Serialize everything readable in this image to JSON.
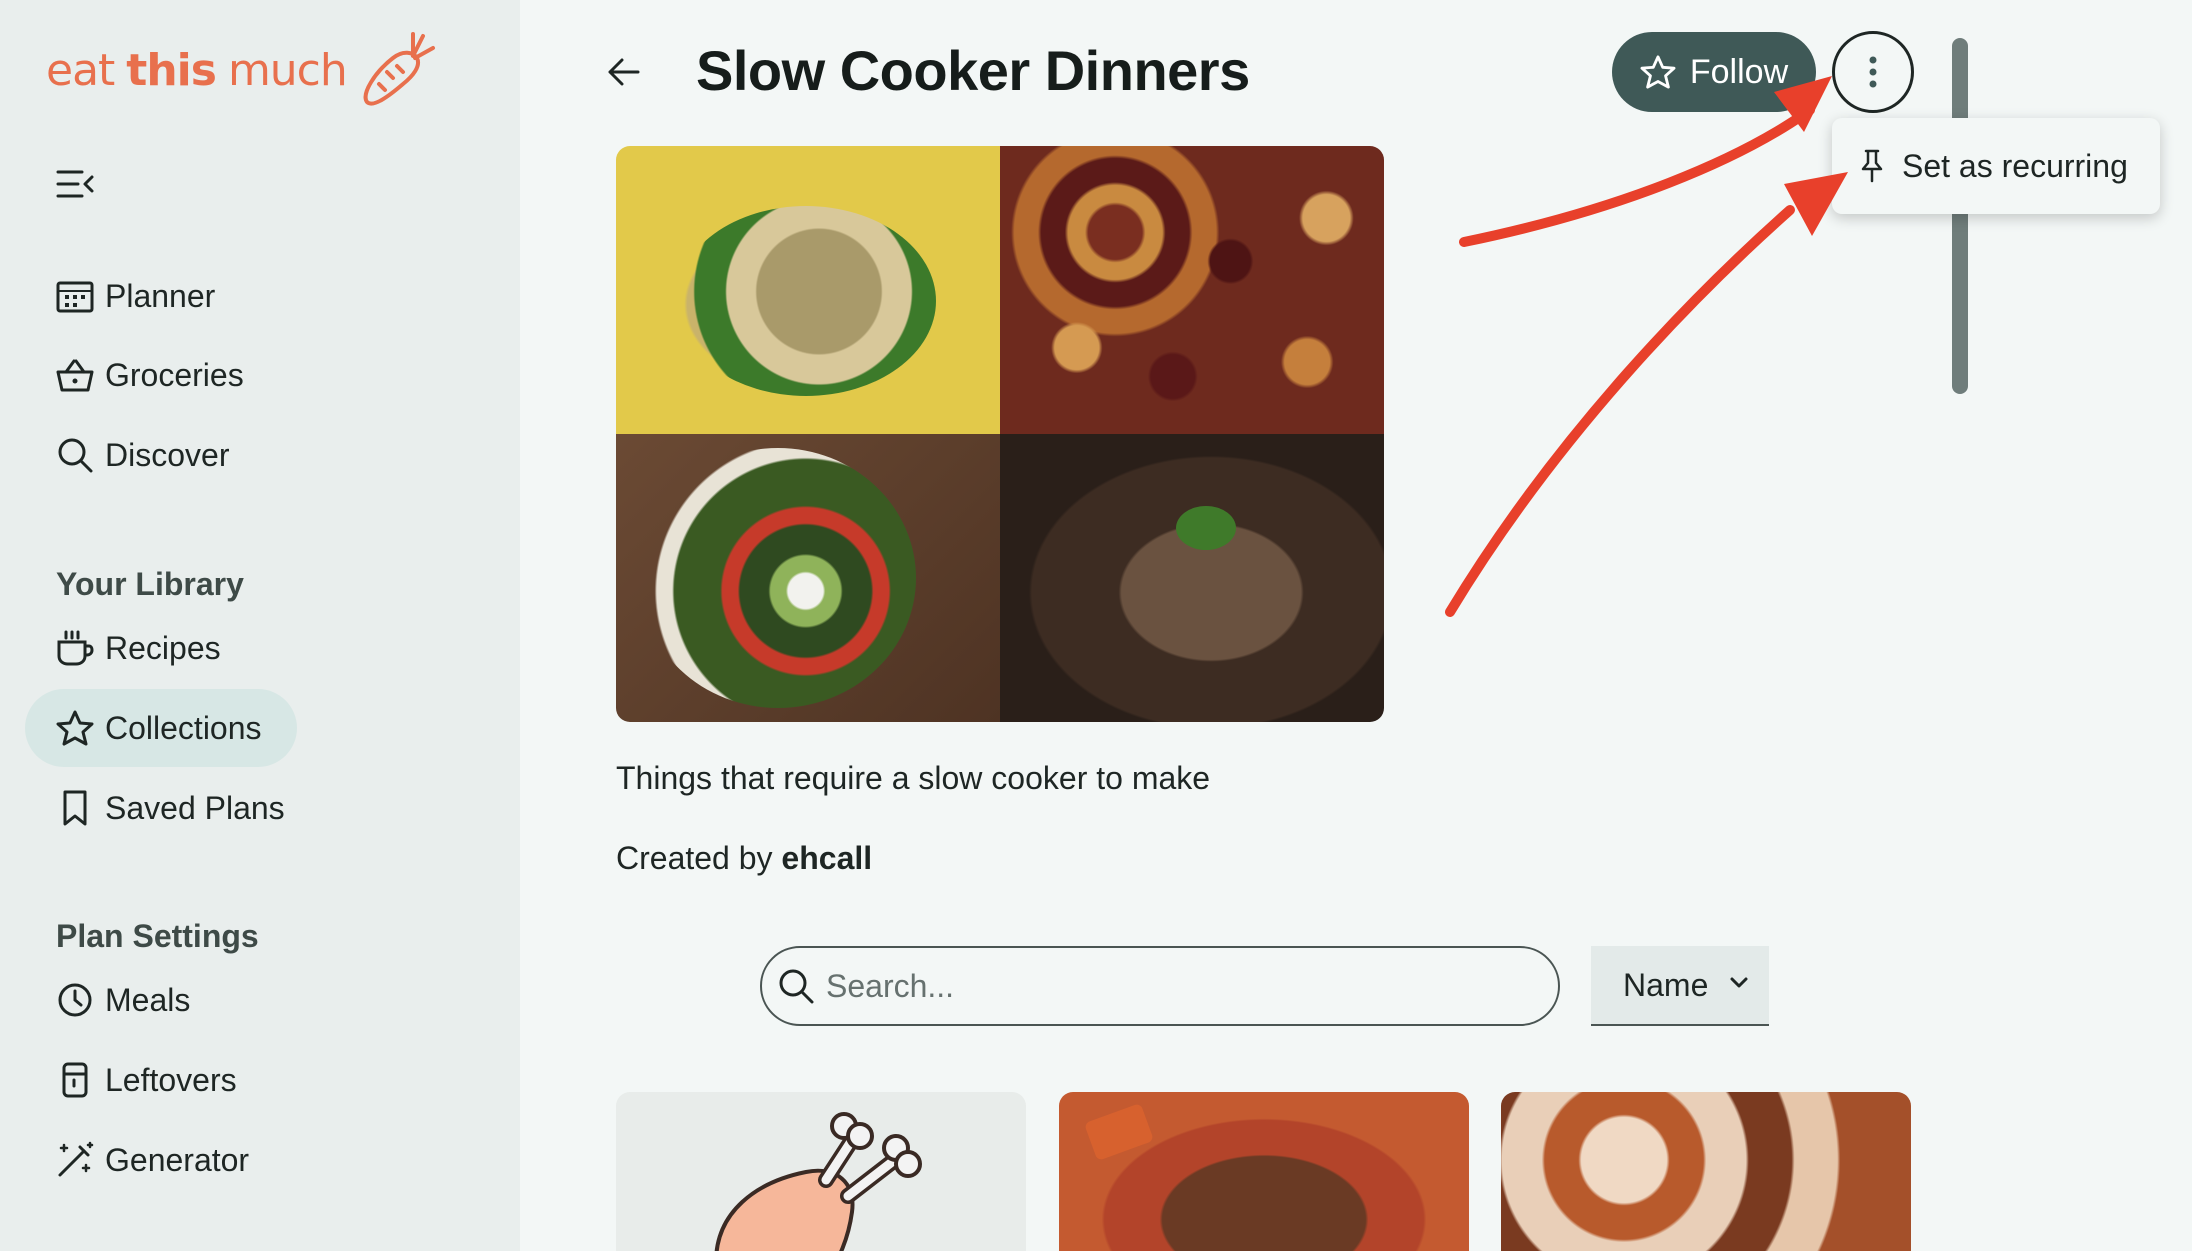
{
  "app": {
    "logo": {
      "word1": "eat",
      "word2": "this",
      "word3": "much"
    }
  },
  "sidebar": {
    "items": [
      {
        "label": "Planner",
        "icon": "calendar-icon"
      },
      {
        "label": "Groceries",
        "icon": "basket-icon"
      },
      {
        "label": "Discover",
        "icon": "search-icon"
      }
    ],
    "library_heading": "Your Library",
    "library_items": [
      {
        "label": "Recipes",
        "icon": "mug-icon"
      },
      {
        "label": "Collections",
        "icon": "star-icon",
        "active": true
      },
      {
        "label": "Saved Plans",
        "icon": "bookmark-icon"
      }
    ],
    "settings_heading": "Plan Settings",
    "settings_items": [
      {
        "label": "Meals",
        "icon": "clock-icon"
      },
      {
        "label": "Leftovers",
        "icon": "container-icon"
      },
      {
        "label": "Generator",
        "icon": "magic-wand-icon"
      }
    ]
  },
  "header": {
    "title": "Slow Cooker Dinners",
    "follow_label": "Follow"
  },
  "menu": {
    "items": [
      {
        "label": "Set as recurring",
        "icon": "pin-icon"
      }
    ]
  },
  "collection": {
    "description": "Things that require a slow cooker to make",
    "created_by_prefix": "Created by",
    "author": "ehcall"
  },
  "search": {
    "placeholder": "Search...",
    "value": ""
  },
  "sort": {
    "selected": "Name"
  },
  "colors": {
    "accent": "#e8704d",
    "follow_bg": "#3f5957",
    "annotation_arrow": "#e8402b",
    "active_nav": "#d7e7e5"
  }
}
